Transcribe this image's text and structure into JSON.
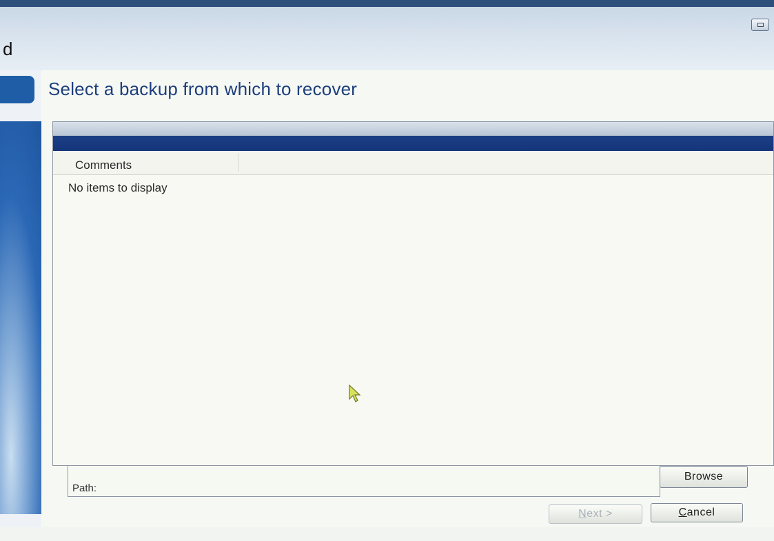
{
  "window": {
    "title_fragment": "d"
  },
  "page": {
    "title": "Select a backup from which to recover"
  },
  "list": {
    "columns": [
      "Comments"
    ],
    "empty_message": "No items to display"
  },
  "path": {
    "label": "Path:",
    "value": ""
  },
  "buttons": {
    "browse": "Browse",
    "next": "Next >",
    "cancel": "Cancel"
  },
  "colors": {
    "title": "#1d3f7c",
    "accent_blue": "#1b3f86",
    "sidebar_blue": "#1f5ea6"
  },
  "icons": {
    "window_control": "restore-icon",
    "pointer": "cursor-arrow-icon"
  }
}
